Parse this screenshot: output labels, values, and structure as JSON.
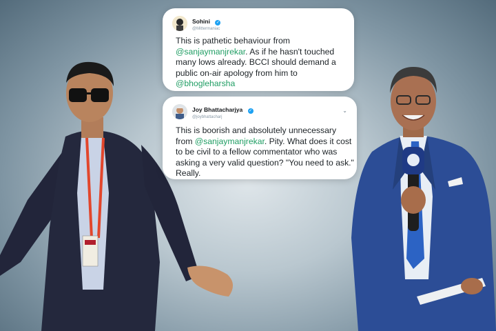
{
  "tweets": [
    {
      "name": "Sohini",
      "handle": "@Mittermaniac",
      "text_parts": [
        {
          "text": "This is pathetic behaviour from ",
          "mention": false
        },
        {
          "text": "@sanjaymanjrekar",
          "mention": true
        },
        {
          "text": ". As if he hasn't touched many lows already. BCCI should demand a public on-air apology from him to ",
          "mention": false
        },
        {
          "text": "@bhogleharsha",
          "mention": true
        }
      ]
    },
    {
      "name": "Joy Bhattacharjya",
      "handle": "@joybhattacharj",
      "text_parts": [
        {
          "text": "This is boorish and absolutely unnecessary from ",
          "mention": false
        },
        {
          "text": "@sanjaymanjrekar",
          "mention": true
        },
        {
          "text": ". Pity. What does it cost to be civil to a fellow commentator who was asking a very valid question? \"You need to ask.\" Really.",
          "mention": false
        }
      ]
    }
  ],
  "colors": {
    "mention": "#1f9d63",
    "verified_badge": "#1da1f2",
    "background": "#9fb0bb"
  },
  "icons": {
    "verified": "verified-badge-icon",
    "caret": "chevron-down-icon"
  }
}
